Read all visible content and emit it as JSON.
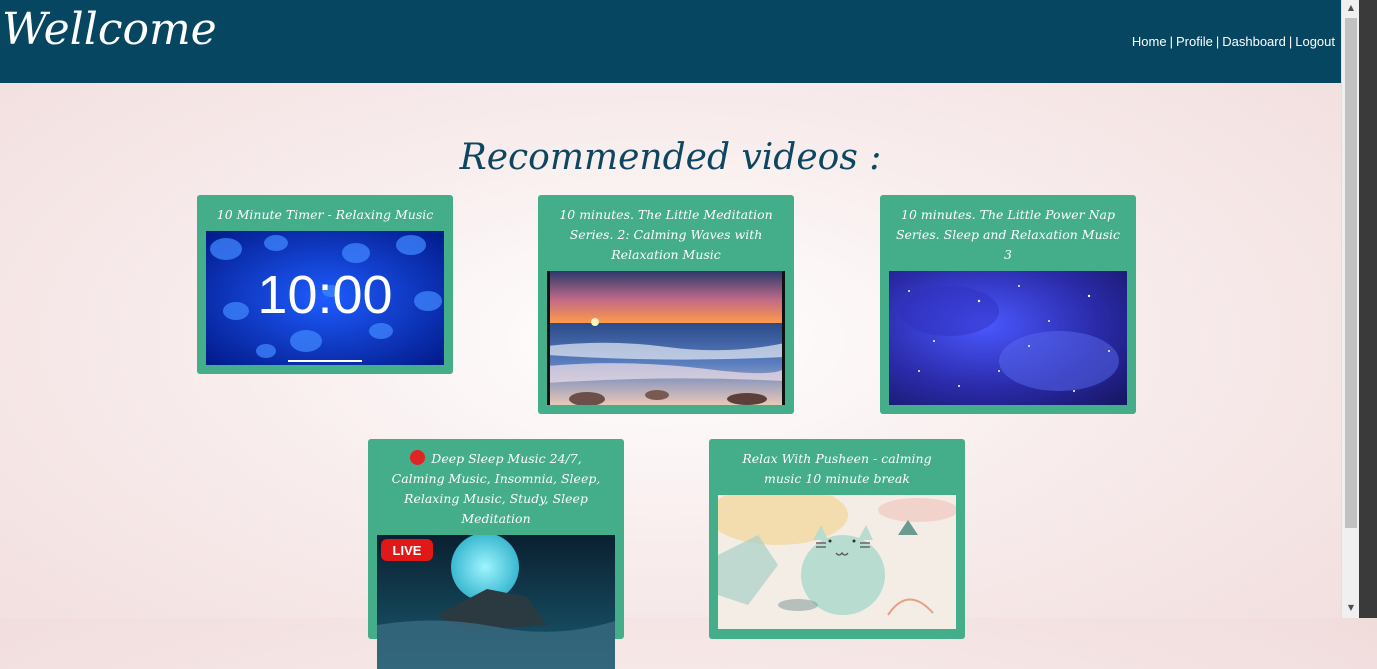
{
  "header": {
    "logo": "Wellcome",
    "nav": [
      "Home",
      "Profile",
      "Dashboard",
      "Logout"
    ],
    "nav_separator": "|",
    "bg_color": "#064660"
  },
  "main": {
    "title": "Recommended videos :",
    "card_color": "#44ad8a"
  },
  "videos": [
    {
      "title": "10 Minute Timer - Relaxing Music",
      "thumb_text": "10:00",
      "thumbnail": "jellyfish-timer"
    },
    {
      "title": "10 minutes. The Little Meditation Series. 2: Calming Waves with Relaxation Music",
      "thumbnail": "ocean-sunset"
    },
    {
      "title": "10 minutes. The Little Power Nap Series. Sleep and Relaxation Music 3",
      "thumbnail": "starry-galaxy"
    },
    {
      "title": "Deep Sleep Music 24/7, Calming Music, Insomnia, Sleep, Relaxing Music, Study, Sleep Meditation",
      "live_indicator": "red-circle",
      "thumb_badge": "LIVE",
      "thumbnail": "moon-rock"
    },
    {
      "title": "Relax With Pusheen - calming music 10 minute break",
      "thumbnail": "pusheen-illustration"
    }
  ]
}
